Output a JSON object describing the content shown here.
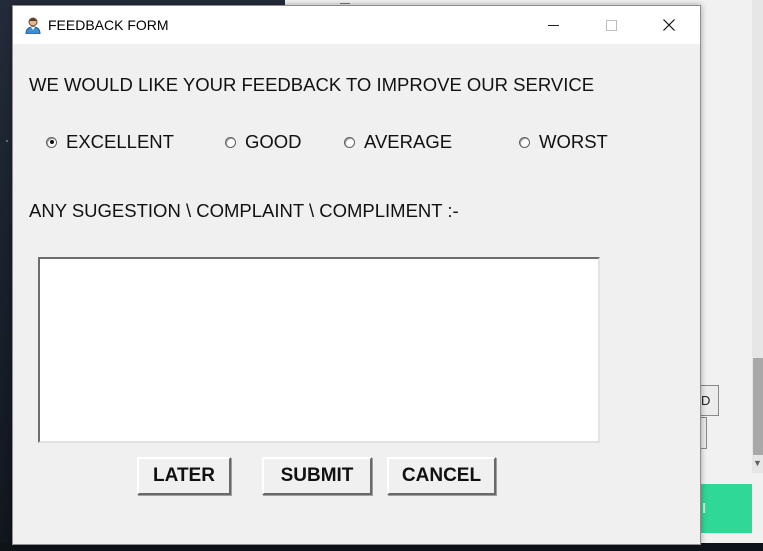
{
  "window": {
    "title": "FEEDBACK FORM",
    "controls": {
      "minimize": "—",
      "maximize": "☐",
      "close": "✕"
    }
  },
  "form": {
    "prompt": "WE WOULD LIKE YOUR FEEDBACK TO IMPROVE OUR SERVICE",
    "rating_options": [
      {
        "label": "EXCELLENT",
        "checked": true
      },
      {
        "label": "GOOD",
        "checked": false
      },
      {
        "label": "AVERAGE",
        "checked": false
      },
      {
        "label": "WORST",
        "checked": false
      }
    ],
    "suggestion_label": "ANY SUGESTION \\ COMPLAINT \\ COMPLIMENT :-",
    "suggestion_value": ""
  },
  "buttons": {
    "later": "LATER",
    "submit": "SUBMIT",
    "cancel": "CANCEL"
  },
  "background_app": {
    "button_fragment_text": "D"
  },
  "colors": {
    "window_bg": "#f0f0f0",
    "titlebar_bg": "#ffffff",
    "accent_green": "#2fd895"
  }
}
